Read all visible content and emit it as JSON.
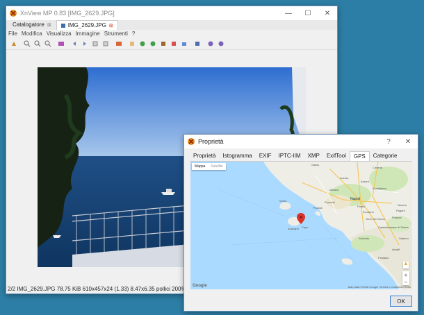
{
  "main": {
    "title": "XnView MP 0.83 [IMG_2629.JPG]",
    "caption": {
      "minimize": "—",
      "maximize": "☐",
      "close": "✕"
    },
    "tabs": [
      {
        "label": "Catalogatore",
        "close": "⊠"
      },
      {
        "label": "IMG_2629.JPG",
        "close": "⊠"
      }
    ],
    "menu": [
      "File",
      "Modifica",
      "Visualizza",
      "Immagine",
      "Strumenti",
      "?"
    ],
    "toolbar_icons": [
      "hand-tool-icon",
      "zoom-in-icon",
      "zoom-out-icon",
      "zoom-fit-icon",
      "fullscreen-icon",
      "prev-icon",
      "next-icon",
      "first-icon",
      "last-icon",
      "slideshow-icon",
      "rotate-left-icon",
      "rotate-right-icon",
      "flip-icon",
      "adjust-icon",
      "crop-icon",
      "resize-icon",
      "effects-icon",
      "settings-icon",
      "info-icon",
      "help-icon"
    ],
    "status": "2/2 IMG_2629.JPG 78.75 KiB 610x457x24 (1.33) 8.47x6.35 pollici 200% X:100"
  },
  "props": {
    "title": "Proprietà",
    "help": "?",
    "close": "✕",
    "tabs": [
      "Proprietà",
      "Istogramma",
      "EXIF",
      "IPTC-IIM",
      "XMP",
      "ExifTool",
      "GPS",
      "Categorie"
    ],
    "active_tab": "GPS",
    "map": {
      "toggle": [
        "Mappa",
        "Satellite"
      ],
      "labels": [
        "Gaeta",
        "Caserta",
        "Aversa",
        "Acerra",
        "Marano",
        "Pomigliano",
        "Napoli",
        "Pozzuoli",
        "Ischia",
        "Portici",
        "Ercolano",
        "Pompei",
        "Torre del Greco",
        "Sorrento",
        "Positano",
        "Capri",
        "Anacapri",
        "Castellammare di Stabia",
        "Nocera",
        "Salerno",
        "Amalfi",
        "Pagani",
        "Procida"
      ],
      "footer": "Map data ©2016 Google   Termini e condizioni d'uso",
      "brand": "Google",
      "zoom_in": "+",
      "zoom_out": "−"
    },
    "ok": "OK"
  }
}
